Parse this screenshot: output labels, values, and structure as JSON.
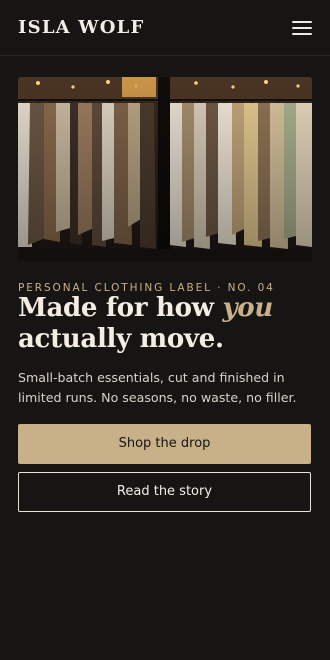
{
  "brand": {
    "name": "ISLA WOLF"
  },
  "header": {
    "menu_icon": "hamburger-menu-icon"
  },
  "hero": {
    "image_description": "photo of clothing racks",
    "eyebrow": "PERSONAL CLOTHING LABEL · NO. 04",
    "headline_part1": "Made for how ",
    "headline_accent": "you",
    "headline_part2": "actually move.",
    "description": "Small-batch essentials, cut and finished in limited runs. No seasons, no waste, no filler."
  },
  "actions": {
    "primary_label": "Shop the drop",
    "secondary_label": "Read the story"
  },
  "colors": {
    "background": "#171514",
    "accent": "#c8b088",
    "text": "#f3ede4"
  }
}
